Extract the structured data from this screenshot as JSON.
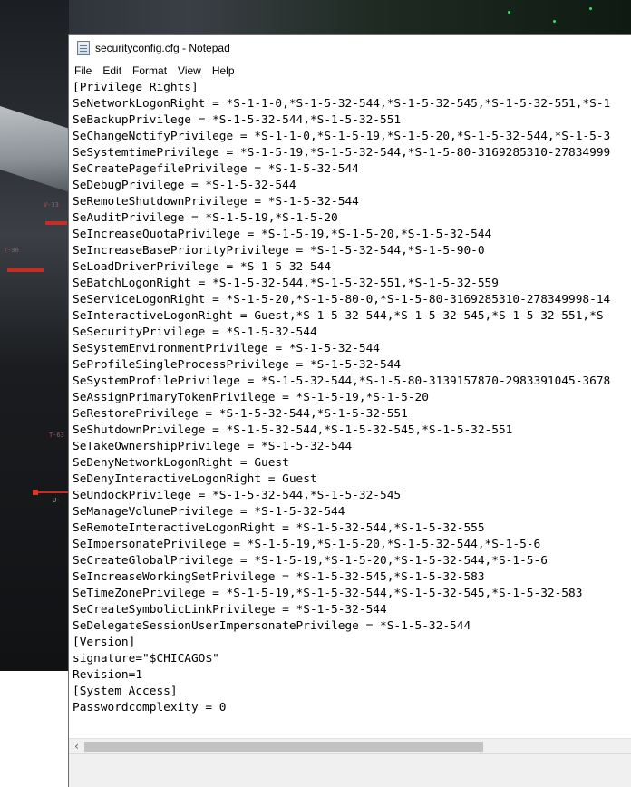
{
  "window": {
    "title": "securityconfig.cfg - Notepad",
    "app_icon": "notepad-icon"
  },
  "menu": {
    "file": "File",
    "edit": "Edit",
    "format": "Format",
    "view": "View",
    "help": "Help"
  },
  "editor": {
    "lines": [
      "[Privilege Rights]",
      "SeNetworkLogonRight = *S-1-1-0,*S-1-5-32-544,*S-1-5-32-545,*S-1-5-32-551,*S-1",
      "SeBackupPrivilege = *S-1-5-32-544,*S-1-5-32-551",
      "SeChangeNotifyPrivilege = *S-1-1-0,*S-1-5-19,*S-1-5-20,*S-1-5-32-544,*S-1-5-3",
      "SeSystemtimePrivilege = *S-1-5-19,*S-1-5-32-544,*S-1-5-80-3169285310-27834999",
      "SeCreatePagefilePrivilege = *S-1-5-32-544",
      "SeDebugPrivilege = *S-1-5-32-544",
      "SeRemoteShutdownPrivilege = *S-1-5-32-544",
      "SeAuditPrivilege = *S-1-5-19,*S-1-5-20",
      "SeIncreaseQuotaPrivilege = *S-1-5-19,*S-1-5-20,*S-1-5-32-544",
      "SeIncreaseBasePriorityPrivilege = *S-1-5-32-544,*S-1-5-90-0",
      "SeLoadDriverPrivilege = *S-1-5-32-544",
      "SeBatchLogonRight = *S-1-5-32-544,*S-1-5-32-551,*S-1-5-32-559",
      "SeServiceLogonRight = *S-1-5-20,*S-1-5-80-0,*S-1-5-80-3169285310-278349998-14",
      "SeInteractiveLogonRight = Guest,*S-1-5-32-544,*S-1-5-32-545,*S-1-5-32-551,*S-",
      "SeSecurityPrivilege = *S-1-5-32-544",
      "SeSystemEnvironmentPrivilege = *S-1-5-32-544",
      "SeProfileSingleProcessPrivilege = *S-1-5-32-544",
      "SeSystemProfilePrivilege = *S-1-5-32-544,*S-1-5-80-3139157870-2983391045-3678",
      "SeAssignPrimaryTokenPrivilege = *S-1-5-19,*S-1-5-20",
      "SeRestorePrivilege = *S-1-5-32-544,*S-1-5-32-551",
      "SeShutdownPrivilege = *S-1-5-32-544,*S-1-5-32-545,*S-1-5-32-551",
      "SeTakeOwnershipPrivilege = *S-1-5-32-544",
      "SeDenyNetworkLogonRight = Guest",
      "SeDenyInteractiveLogonRight = Guest",
      "SeUndockPrivilege = *S-1-5-32-544,*S-1-5-32-545",
      "SeManageVolumePrivilege = *S-1-5-32-544",
      "SeRemoteInteractiveLogonRight = *S-1-5-32-544,*S-1-5-32-555",
      "SeImpersonatePrivilege = *S-1-5-19,*S-1-5-20,*S-1-5-32-544,*S-1-5-6",
      "SeCreateGlobalPrivilege = *S-1-5-19,*S-1-5-20,*S-1-5-32-544,*S-1-5-6",
      "SeIncreaseWorkingSetPrivilege = *S-1-5-32-545,*S-1-5-32-583",
      "SeTimeZonePrivilege = *S-1-5-19,*S-1-5-32-544,*S-1-5-32-545,*S-1-5-32-583",
      "SeCreateSymbolicLinkPrivilege = *S-1-5-32-544",
      "SeDelegateSessionUserImpersonatePrivilege = *S-1-5-32-544",
      "[Version]",
      "signature=\"$CHICAGO$\"",
      "Revision=1",
      "[System Access]",
      "Passwordcomplexity = 0"
    ]
  },
  "scrollbar": {
    "left_arrow": "‹"
  },
  "wallpaper": {
    "hud_labels": [
      "V-33",
      "T-90",
      "T-63",
      "U-"
    ]
  }
}
